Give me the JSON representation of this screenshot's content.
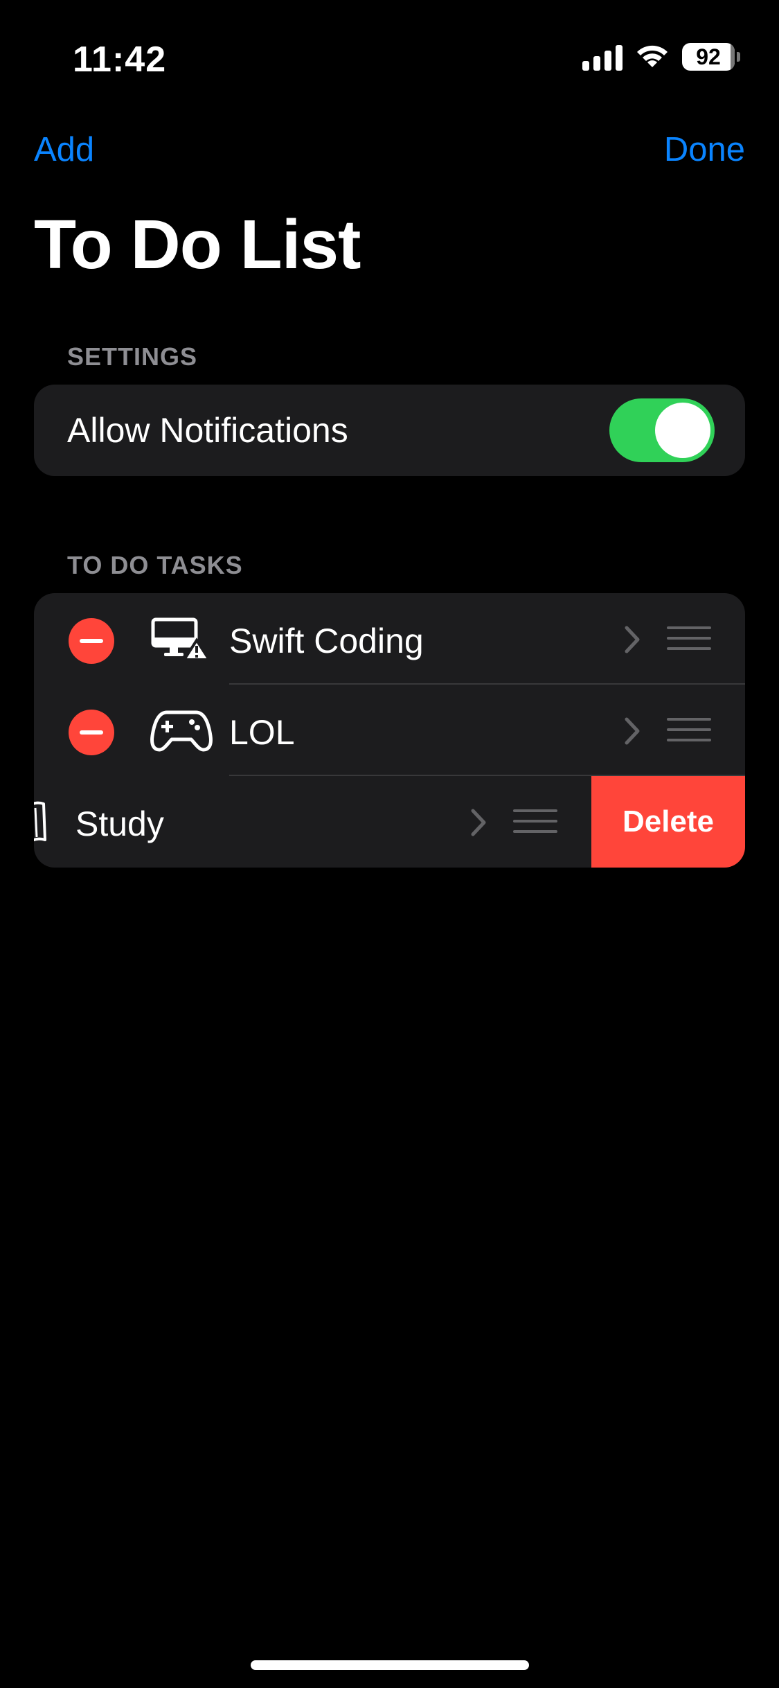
{
  "status_bar": {
    "time": "11:42",
    "battery_percent": "92",
    "signal_icon": "cellular-signal-icon",
    "wifi_icon": "wifi-icon"
  },
  "nav": {
    "add_label": "Add",
    "done_label": "Done"
  },
  "title": "To Do List",
  "settings": {
    "header": "SETTINGS",
    "allow_notifications_label": "Allow Notifications",
    "allow_notifications_on": true
  },
  "tasks": {
    "header": "TO DO TASKS",
    "items": [
      {
        "label": "Swift Coding",
        "icon": "desktop-warning-icon"
      },
      {
        "label": "LOL",
        "icon": "gamecontroller-icon"
      },
      {
        "label": "Study",
        "icon": "book-icon"
      }
    ],
    "delete_label": "Delete"
  },
  "colors": {
    "accent": "#0a84ff",
    "toggle_on": "#30d158",
    "destructive": "#ff453a",
    "cell_background": "#1c1c1e",
    "background": "#000000"
  }
}
